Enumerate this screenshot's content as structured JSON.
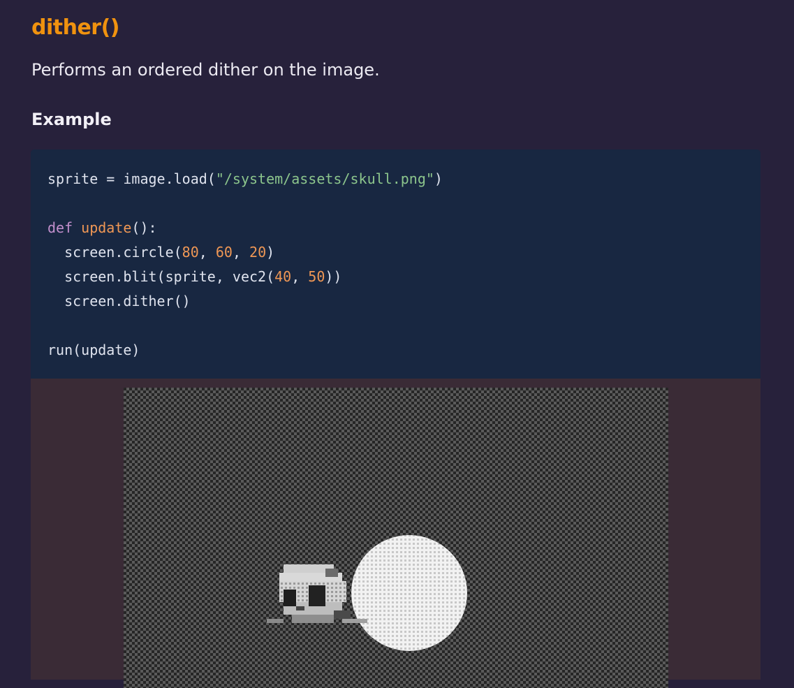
{
  "heading": "dither()",
  "description": "Performs an ordered dither on the image.",
  "example_heading": "Example",
  "code": {
    "line1": {
      "a": "sprite = image.load(",
      "str": "\"/system/assets/skull.png\"",
      "b": ")"
    },
    "line2": {
      "kw": "def",
      "fn": "update",
      "b": "():"
    },
    "line3": {
      "a": "  screen.circle(",
      "n1": "80",
      "c1": ", ",
      "n2": "60",
      "c2": ", ",
      "n3": "20",
      "b": ")"
    },
    "line4": {
      "a": "  screen.blit(sprite, vec2(",
      "n1": "40",
      "c1": ", ",
      "n2": "50",
      "b": "))"
    },
    "line5": {
      "a": "  screen.dither()"
    },
    "line6": {
      "a": "run(update)"
    }
  },
  "colors": {
    "background": "#27213b",
    "heading": "#f0920f",
    "code_background": "#182741",
    "string": "#8cc58c",
    "keyword": "#c28fcc",
    "function": "#ef9755",
    "preview_background": "#3a2b36"
  },
  "preview": {
    "image_name": "dithered-circle-and-skull-output"
  }
}
